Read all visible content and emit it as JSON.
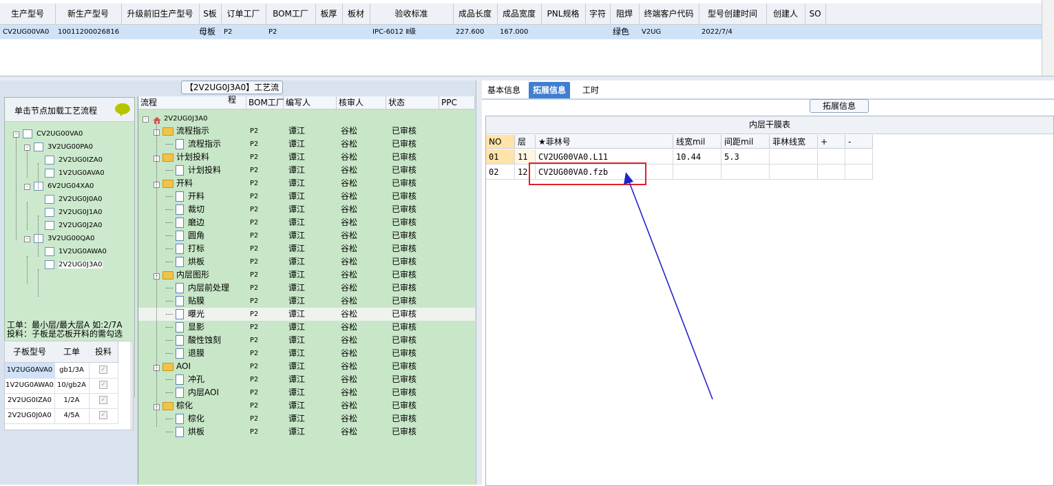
{
  "top_grid": {
    "columns": [
      "生产型号",
      "新生产型号",
      "升级前旧生产型号",
      "S板",
      "订单工厂",
      "BOM工厂",
      "板厚",
      "板材",
      "验收标准",
      "成品长度",
      "成品宽度",
      "PNL规格",
      "字符",
      "阻焊",
      "终端客户代码",
      "型号创建时间",
      "创建人",
      "SO"
    ],
    "row": {
      "model": "CV2UG00VA0",
      "new_model": "10011200026816",
      "old_model": "",
      "s_board": "母板",
      "order_factory": "P2",
      "bom_factory": "P2",
      "thickness": "",
      "material": "",
      "standard": "IPC-6012 Ⅱ级",
      "length": "227.600",
      "width": "167.000",
      "pnl": "",
      "char": "",
      "solder_mask": "绿色",
      "customer_code": "V2UG",
      "created": "2022/7/4",
      "creator": "",
      "so": ""
    }
  },
  "left": {
    "header": "单击节点加载工艺流程",
    "tree": [
      {
        "label": "CV2UG00VA0",
        "level": 0,
        "sign": "-"
      },
      {
        "label": "3V2UG00PA0",
        "level": 1,
        "sign": "-"
      },
      {
        "label": "2V2UG0IZA0",
        "level": 2
      },
      {
        "label": "1V2UG0AVA0",
        "level": 2
      },
      {
        "label": "6V2UG04XA0",
        "level": 1,
        "sign": "-"
      },
      {
        "label": "2V2UG0J0A0",
        "level": 2
      },
      {
        "label": "2V2UG0J1A0",
        "level": 2
      },
      {
        "label": "2V2UG0J2A0",
        "level": 2
      },
      {
        "label": "3V2UG00QA0",
        "level": 1,
        "sign": "-"
      },
      {
        "label": "1V2UG0AWA0",
        "level": 2
      },
      {
        "label": "2V2UG0J3A0",
        "level": 2
      }
    ],
    "note_line1": "工单：最小层/最大层A 如:2/7A",
    "note_line2": "投料：子板是芯板开料的需勾选",
    "sub_grid": {
      "columns": [
        "子板型号",
        "工单",
        "投料"
      ],
      "rows": [
        {
          "model": "1V2UG0AVA0",
          "order": "gb1/3A"
        },
        {
          "model": "1V2UG0AWA0",
          "order": "10/gb2A"
        },
        {
          "model": "2V2UG0IZA0",
          "order": "1/2A"
        },
        {
          "model": "2V2UG0J0A0",
          "order": "4/5A"
        }
      ]
    }
  },
  "middle": {
    "title": "【2V2UG0J3A0】工艺流程",
    "columns": [
      "流程",
      "BOM工厂",
      "编写人",
      "核审人",
      "状态",
      "PPC"
    ],
    "root": "2V2UG0J3A0",
    "rows": [
      {
        "name": "流程指示",
        "type": "folder",
        "bom": "P2",
        "writer": "谭江",
        "reviewer": "谷松",
        "status": "已审核"
      },
      {
        "name": "流程指示",
        "type": "doc",
        "bom": "P2",
        "writer": "谭江",
        "reviewer": "谷松",
        "status": "已审核"
      },
      {
        "name": "计划投料",
        "type": "folder",
        "bom": "P2",
        "writer": "谭江",
        "reviewer": "谷松",
        "status": "已审核"
      },
      {
        "name": "计划投料",
        "type": "doc",
        "bom": "P2",
        "writer": "谭江",
        "reviewer": "谷松",
        "status": "已审核"
      },
      {
        "name": "开料",
        "type": "folder",
        "bom": "P2",
        "writer": "谭江",
        "reviewer": "谷松",
        "status": "已审核"
      },
      {
        "name": "开料",
        "type": "doc",
        "bom": "P2",
        "writer": "谭江",
        "reviewer": "谷松",
        "status": "已审核"
      },
      {
        "name": "裁切",
        "type": "doc",
        "bom": "P2",
        "writer": "谭江",
        "reviewer": "谷松",
        "status": "已审核"
      },
      {
        "name": "磨边",
        "type": "doc",
        "bom": "P2",
        "writer": "谭江",
        "reviewer": "谷松",
        "status": "已审核"
      },
      {
        "name": "圆角",
        "type": "doc",
        "bom": "P2",
        "writer": "谭江",
        "reviewer": "谷松",
        "status": "已审核"
      },
      {
        "name": "打标",
        "type": "doc",
        "bom": "P2",
        "writer": "谭江",
        "reviewer": "谷松",
        "status": "已审核"
      },
      {
        "name": "烘板",
        "type": "doc",
        "bom": "P2",
        "writer": "谭江",
        "reviewer": "谷松",
        "status": "已审核"
      },
      {
        "name": "内层图形",
        "type": "folder",
        "bom": "P2",
        "writer": "谭江",
        "reviewer": "谷松",
        "status": "已审核"
      },
      {
        "name": "内层前处理",
        "type": "doc",
        "bom": "P2",
        "writer": "谭江",
        "reviewer": "谷松",
        "status": "已审核"
      },
      {
        "name": "贴膜",
        "type": "doc",
        "bom": "P2",
        "writer": "谭江",
        "reviewer": "谷松",
        "status": "已审核"
      },
      {
        "name": "曝光",
        "type": "doc",
        "bom": "P2",
        "writer": "谭江",
        "reviewer": "谷松",
        "status": "已审核",
        "selected": true
      },
      {
        "name": "显影",
        "type": "doc",
        "bom": "P2",
        "writer": "谭江",
        "reviewer": "谷松",
        "status": "已审核"
      },
      {
        "name": "酸性蚀刻",
        "type": "doc",
        "bom": "P2",
        "writer": "谭江",
        "reviewer": "谷松",
        "status": "已审核"
      },
      {
        "name": "退膜",
        "type": "doc",
        "bom": "P2",
        "writer": "谭江",
        "reviewer": "谷松",
        "status": "已审核"
      },
      {
        "name": "AOI",
        "type": "folder",
        "bom": "P2",
        "writer": "谭江",
        "reviewer": "谷松",
        "status": "已审核"
      },
      {
        "name": "冲孔",
        "type": "doc",
        "bom": "P2",
        "writer": "谭江",
        "reviewer": "谷松",
        "status": "已审核"
      },
      {
        "name": "内层AOI",
        "type": "doc",
        "bom": "P2",
        "writer": "谭江",
        "reviewer": "谷松",
        "status": "已审核"
      },
      {
        "name": "棕化",
        "type": "folder",
        "bom": "P2",
        "writer": "谭江",
        "reviewer": "谷松",
        "status": "已审核"
      },
      {
        "name": "棕化",
        "type": "doc",
        "bom": "P2",
        "writer": "谭江",
        "reviewer": "谷松",
        "status": "已审核"
      },
      {
        "name": "烘板",
        "type": "doc",
        "bom": "P2",
        "writer": "谭江",
        "reviewer": "谷松",
        "status": "已审核"
      }
    ]
  },
  "right": {
    "tabs": [
      "基本信息",
      "拓展信息",
      "工时"
    ],
    "active_tab": 1,
    "section_label": "拓展信息",
    "table_title": "内层干膜表",
    "columns": [
      "NO",
      "层",
      "★菲林号",
      "线宽mil",
      "间距mil",
      "菲林线宽",
      "+",
      "-"
    ],
    "rows": [
      {
        "no": "01",
        "layer": "11",
        "film": "CV2UG00VA0.L11",
        "line_width": "10.44",
        "spacing": "5.3",
        "film_width": ""
      },
      {
        "no": "02",
        "layer": "12",
        "film": "CV2UG00VA0.fzb",
        "line_width": "",
        "spacing": "",
        "film_width": ""
      }
    ]
  },
  "colors": {
    "accent": "#3f7fd1",
    "tree_bg": "#c8e6c8",
    "annotation_box": "#e0202a",
    "annotation_arrow": "#2222cc"
  }
}
